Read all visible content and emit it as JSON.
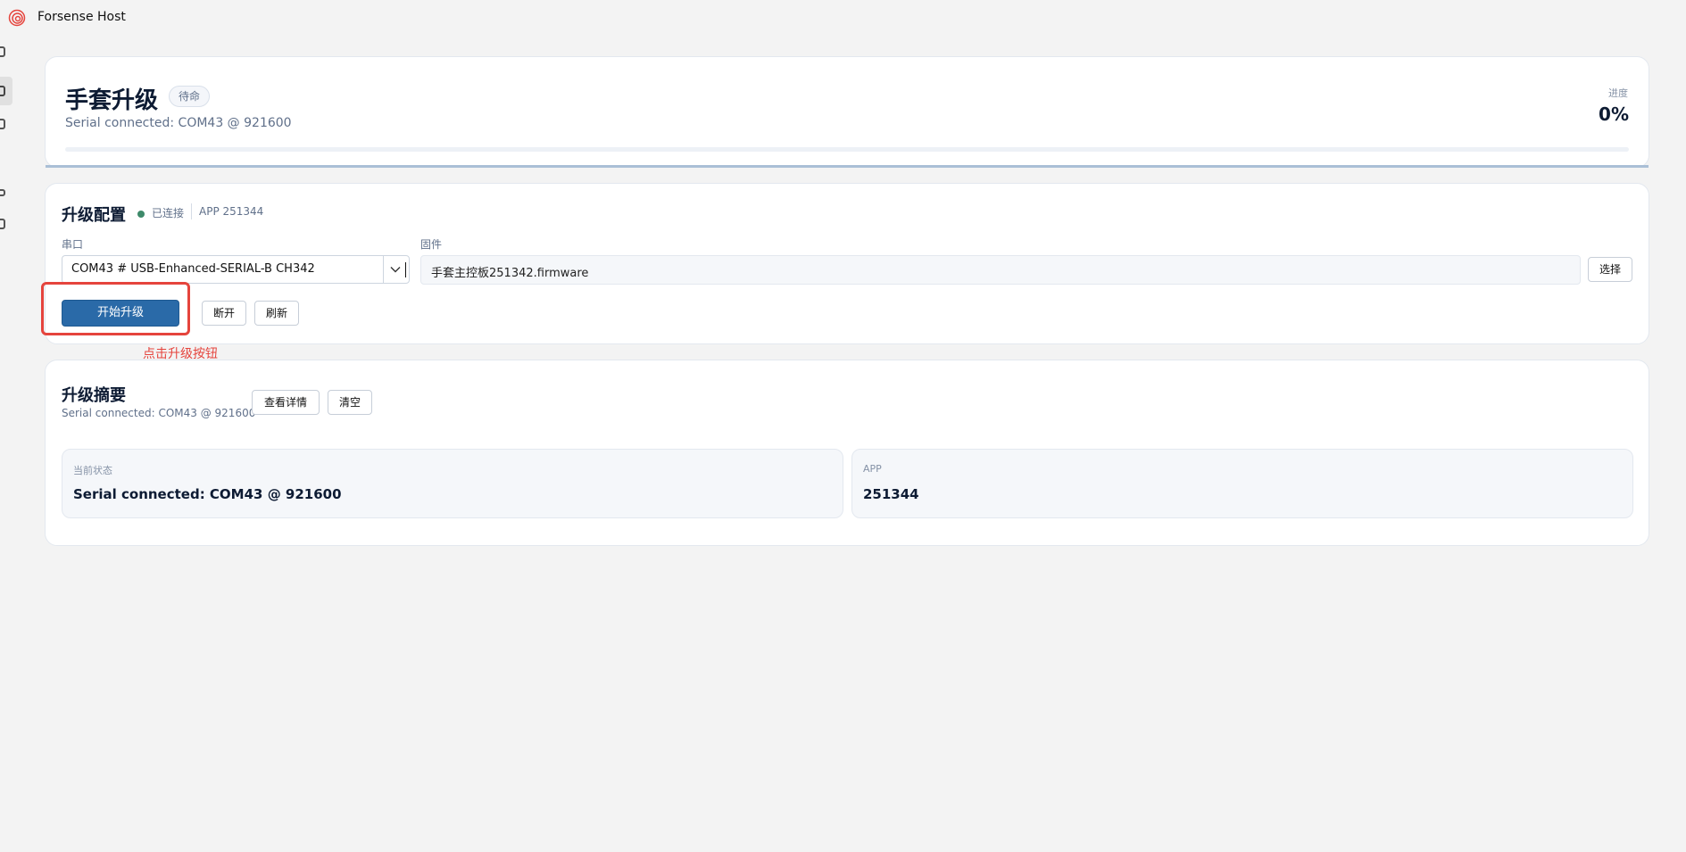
{
  "app": {
    "title": "Forsense Host",
    "logo_icon": "spiral-logo-icon",
    "accent": "#2a6aa8"
  },
  "header": {
    "title": "手套升级",
    "badge": "待命",
    "subtitle": "Serial connected: COM43 @ 921600",
    "progress_label": "进度",
    "progress_value": "0%",
    "progress_fraction": 0
  },
  "config": {
    "title": "升级配置",
    "status_text": "已连接",
    "status_color": "#3e8a6a",
    "app_text": "APP 251344",
    "port_label": "串口",
    "port_value": "COM43 # USB-Enhanced-SERIAL-B CH342",
    "firmware_label": "固件",
    "firmware_value": "手套主控板251342.firmware",
    "choose_button": "选择",
    "start_button": "开始升级",
    "disconnect_button": "断开",
    "refresh_button": "刷新"
  },
  "annotation": {
    "note": "点击升级按钮",
    "color": "#e5443d"
  },
  "summary": {
    "title": "升级摘要",
    "subtitle": "Serial connected: COM43 @ 921600",
    "details_button": "查看详情",
    "clear_button": "清空",
    "stats": [
      {
        "label": "当前状态",
        "value": "Serial connected: COM43 @ 921600"
      },
      {
        "label": "APP",
        "value": "251344"
      }
    ]
  }
}
